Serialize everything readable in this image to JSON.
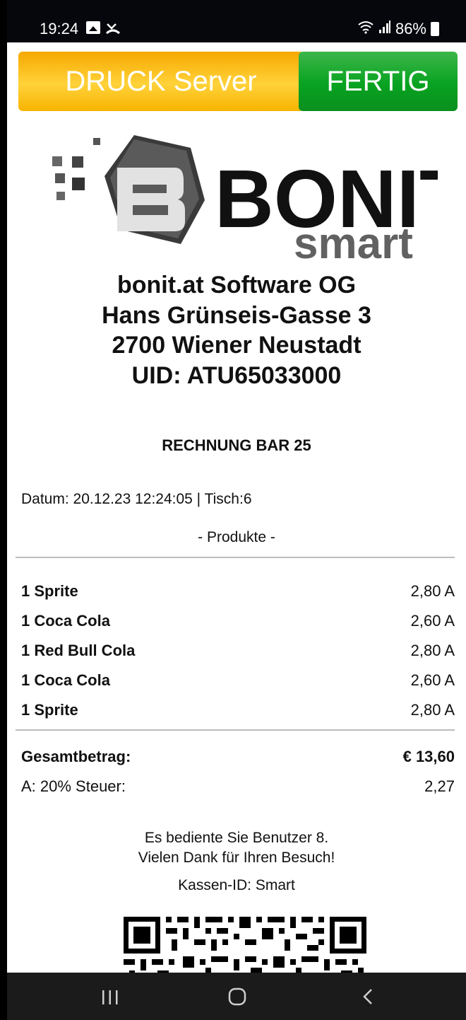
{
  "status_bar": {
    "time": "19:24",
    "battery": "86%",
    "icons": [
      "gallery-icon",
      "missed-call-icon",
      "wifi-icon",
      "signal-icon",
      "battery-icon"
    ]
  },
  "actions": {
    "print_server_label": "DRUCK Server",
    "done_label": "FERTIG"
  },
  "logo": {
    "brand": "BONIT",
    "sub": "smart"
  },
  "company": {
    "name": "bonit.at Software OG",
    "street": "Hans Grünseis-Gasse 3",
    "city": "2700 Wiener Neustadt",
    "uid": "UID: ATU65033000"
  },
  "receipt": {
    "title": "RECHNUNG BAR 25",
    "meta": "Datum: 20.12.23 12:24:05 | Tisch:6",
    "section_label": "- Produkte -",
    "items": [
      {
        "name": "1 Sprite",
        "price": "2,80 A"
      },
      {
        "name": "1 Coca Cola",
        "price": "2,60 A"
      },
      {
        "name": "1 Red Bull Cola",
        "price": "2,80 A"
      },
      {
        "name": "1 Coca Cola",
        "price": "2,60 A"
      },
      {
        "name": "1 Sprite",
        "price": "2,80 A"
      }
    ],
    "total_label": "Gesamtbetrag:",
    "total_value": "€ 13,60",
    "tax_label": "A: 20% Steuer:",
    "tax_value": "2,27",
    "served_by": "Es bediente Sie Benutzer 8.",
    "thanks": "Vielen Dank für Ihren Besuch!",
    "register_id": "Kassen-ID: Smart"
  },
  "colors": {
    "print_button": "#f7b400",
    "done_button": "#08a321",
    "status_bar": "#05070c",
    "nav_bar": "#1b1b1b"
  }
}
